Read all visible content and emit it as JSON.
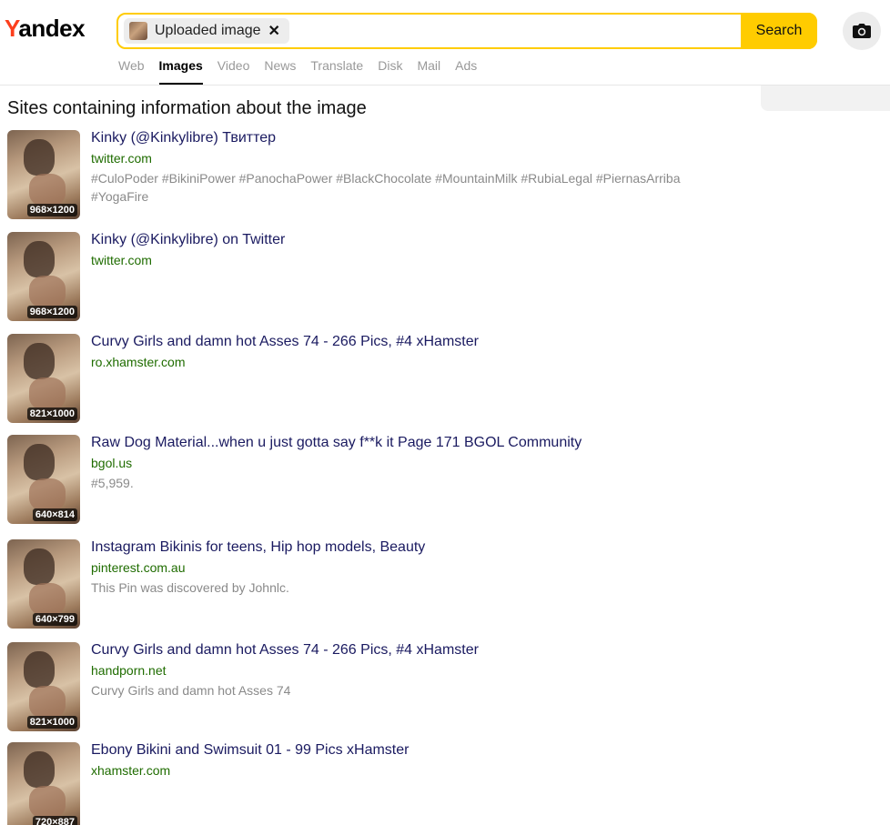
{
  "header": {
    "logo_first": "Y",
    "logo_rest": "andex",
    "search": {
      "chip_label": "Uploaded image",
      "chip_close": "✕",
      "button_label": "Search"
    },
    "nav": [
      "Web",
      "Images",
      "Video",
      "News",
      "Translate",
      "Disk",
      "Mail",
      "Ads"
    ],
    "nav_active": "Images"
  },
  "section_title": "Sites containing information about the image",
  "results": [
    {
      "title": "Kinky (@Kinkylibre) Твиттер",
      "domain": "twitter.com",
      "desc": "#CuloPoder #BikiniPower #PanochaPower #BlackChocolate #MountainMilk #RubiaLegal #PiernasArriba #YogaFire",
      "dims": "968×1200"
    },
    {
      "title": "Kinky (@Kinkylibre) on Twitter",
      "domain": "twitter.com",
      "desc": "",
      "dims": "968×1200"
    },
    {
      "title": "Curvy Girls and damn hot Asses 74 - 266 Pics, #4 xHamster",
      "domain": "ro.xhamster.com",
      "desc": "",
      "dims": "821×1000"
    },
    {
      "title": "Raw Dog Material...when u just gotta say f**k it Page 171 BGOL Community",
      "domain": "bgol.us",
      "desc": "#5,959.",
      "dims": "640×814"
    },
    {
      "title": "Instagram Bikinis for teens, Hip hop models, Beauty",
      "domain": "pinterest.com.au",
      "desc": "This Pin was discovered by Johnlc.",
      "dims": "640×799"
    },
    {
      "title": "Curvy Girls and damn hot Asses 74 - 266 Pics, #4 xHamster",
      "domain": "handporn.net",
      "desc": "Curvy Girls and damn hot Asses 74",
      "dims": "821×1000"
    },
    {
      "title": "Ebony Bikini and Swimsuit 01 - 99 Pics xHamster",
      "domain": "xhamster.com",
      "desc": "",
      "dims": "720×887"
    }
  ]
}
